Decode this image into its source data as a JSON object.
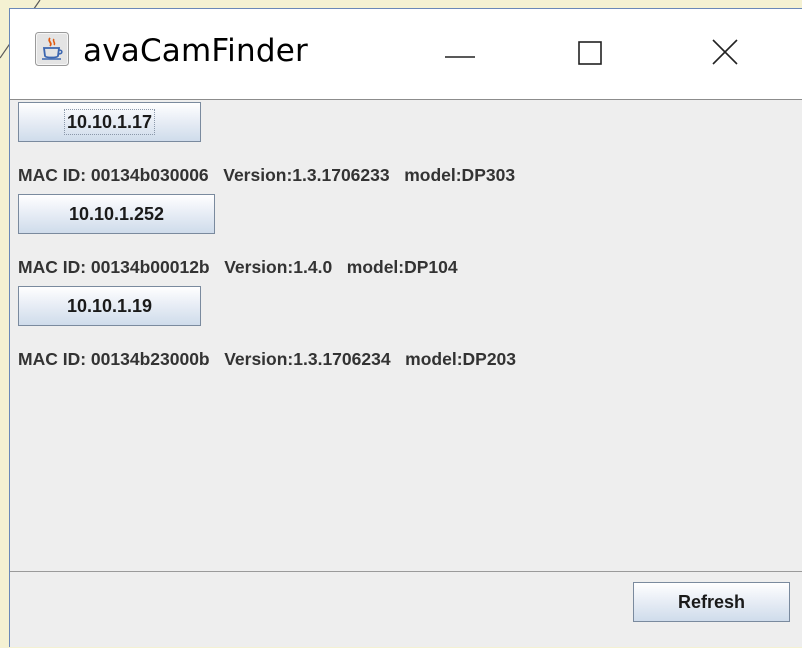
{
  "window": {
    "title": "avaCamFinder",
    "controls": {
      "minimize_icon": "minimize-icon",
      "maximize_icon": "maximize-icon",
      "close_icon": "close-icon"
    },
    "app_icon": "java-coffee-cup-icon"
  },
  "devices": [
    {
      "ip": "10.10.1.17",
      "info": "MAC ID: 00134b030006   Version:1.3.1706233   model:DP303"
    },
    {
      "ip": "10.10.1.252",
      "info": "MAC ID: 00134b00012b   Version:1.4.0   model:DP104"
    },
    {
      "ip": "10.10.1.19",
      "info": "MAC ID: 00134b23000b   Version:1.3.1706234   model:DP203"
    }
  ],
  "footer": {
    "refresh_label": "Refresh"
  },
  "colors": {
    "desktop_background": "#f4f1d2",
    "panel_background": "#eeeeee",
    "title_bar_background": "#ffffff",
    "window_border": "#6a88b8"
  }
}
